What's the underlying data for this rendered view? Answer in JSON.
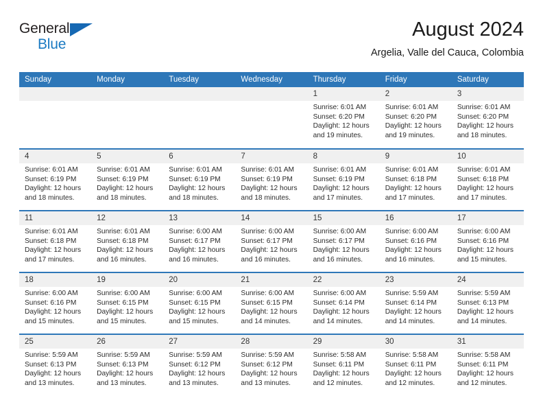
{
  "brand": {
    "name_top": "General",
    "name_bottom": "Blue",
    "flag_icon": "blue-triangle-flag-icon",
    "color_dark": "#231f20",
    "color_blue": "#1b7ac2"
  },
  "header": {
    "title": "August 2024",
    "subtitle": "Argelia, Valle del Cauca, Colombia"
  },
  "theme": {
    "header_blue": "#2e77b8",
    "daynum_gray": "#f0f0f0",
    "text": "#2b2b2b"
  },
  "weekday_headers": [
    "Sunday",
    "Monday",
    "Tuesday",
    "Wednesday",
    "Thursday",
    "Friday",
    "Saturday"
  ],
  "weeks": [
    [
      {
        "day": "",
        "sunrise": "",
        "sunset": "",
        "daylight_line1": "",
        "daylight_line2": ""
      },
      {
        "day": "",
        "sunrise": "",
        "sunset": "",
        "daylight_line1": "",
        "daylight_line2": ""
      },
      {
        "day": "",
        "sunrise": "",
        "sunset": "",
        "daylight_line1": "",
        "daylight_line2": ""
      },
      {
        "day": "",
        "sunrise": "",
        "sunset": "",
        "daylight_line1": "",
        "daylight_line2": ""
      },
      {
        "day": "1",
        "sunrise": "Sunrise: 6:01 AM",
        "sunset": "Sunset: 6:20 PM",
        "daylight_line1": "Daylight: 12 hours",
        "daylight_line2": "and 19 minutes."
      },
      {
        "day": "2",
        "sunrise": "Sunrise: 6:01 AM",
        "sunset": "Sunset: 6:20 PM",
        "daylight_line1": "Daylight: 12 hours",
        "daylight_line2": "and 19 minutes."
      },
      {
        "day": "3",
        "sunrise": "Sunrise: 6:01 AM",
        "sunset": "Sunset: 6:20 PM",
        "daylight_line1": "Daylight: 12 hours",
        "daylight_line2": "and 18 minutes."
      }
    ],
    [
      {
        "day": "4",
        "sunrise": "Sunrise: 6:01 AM",
        "sunset": "Sunset: 6:19 PM",
        "daylight_line1": "Daylight: 12 hours",
        "daylight_line2": "and 18 minutes."
      },
      {
        "day": "5",
        "sunrise": "Sunrise: 6:01 AM",
        "sunset": "Sunset: 6:19 PM",
        "daylight_line1": "Daylight: 12 hours",
        "daylight_line2": "and 18 minutes."
      },
      {
        "day": "6",
        "sunrise": "Sunrise: 6:01 AM",
        "sunset": "Sunset: 6:19 PM",
        "daylight_line1": "Daylight: 12 hours",
        "daylight_line2": "and 18 minutes."
      },
      {
        "day": "7",
        "sunrise": "Sunrise: 6:01 AM",
        "sunset": "Sunset: 6:19 PM",
        "daylight_line1": "Daylight: 12 hours",
        "daylight_line2": "and 18 minutes."
      },
      {
        "day": "8",
        "sunrise": "Sunrise: 6:01 AM",
        "sunset": "Sunset: 6:19 PM",
        "daylight_line1": "Daylight: 12 hours",
        "daylight_line2": "and 17 minutes."
      },
      {
        "day": "9",
        "sunrise": "Sunrise: 6:01 AM",
        "sunset": "Sunset: 6:18 PM",
        "daylight_line1": "Daylight: 12 hours",
        "daylight_line2": "and 17 minutes."
      },
      {
        "day": "10",
        "sunrise": "Sunrise: 6:01 AM",
        "sunset": "Sunset: 6:18 PM",
        "daylight_line1": "Daylight: 12 hours",
        "daylight_line2": "and 17 minutes."
      }
    ],
    [
      {
        "day": "11",
        "sunrise": "Sunrise: 6:01 AM",
        "sunset": "Sunset: 6:18 PM",
        "daylight_line1": "Daylight: 12 hours",
        "daylight_line2": "and 17 minutes."
      },
      {
        "day": "12",
        "sunrise": "Sunrise: 6:01 AM",
        "sunset": "Sunset: 6:18 PM",
        "daylight_line1": "Daylight: 12 hours",
        "daylight_line2": "and 16 minutes."
      },
      {
        "day": "13",
        "sunrise": "Sunrise: 6:00 AM",
        "sunset": "Sunset: 6:17 PM",
        "daylight_line1": "Daylight: 12 hours",
        "daylight_line2": "and 16 minutes."
      },
      {
        "day": "14",
        "sunrise": "Sunrise: 6:00 AM",
        "sunset": "Sunset: 6:17 PM",
        "daylight_line1": "Daylight: 12 hours",
        "daylight_line2": "and 16 minutes."
      },
      {
        "day": "15",
        "sunrise": "Sunrise: 6:00 AM",
        "sunset": "Sunset: 6:17 PM",
        "daylight_line1": "Daylight: 12 hours",
        "daylight_line2": "and 16 minutes."
      },
      {
        "day": "16",
        "sunrise": "Sunrise: 6:00 AM",
        "sunset": "Sunset: 6:16 PM",
        "daylight_line1": "Daylight: 12 hours",
        "daylight_line2": "and 16 minutes."
      },
      {
        "day": "17",
        "sunrise": "Sunrise: 6:00 AM",
        "sunset": "Sunset: 6:16 PM",
        "daylight_line1": "Daylight: 12 hours",
        "daylight_line2": "and 15 minutes."
      }
    ],
    [
      {
        "day": "18",
        "sunrise": "Sunrise: 6:00 AM",
        "sunset": "Sunset: 6:16 PM",
        "daylight_line1": "Daylight: 12 hours",
        "daylight_line2": "and 15 minutes."
      },
      {
        "day": "19",
        "sunrise": "Sunrise: 6:00 AM",
        "sunset": "Sunset: 6:15 PM",
        "daylight_line1": "Daylight: 12 hours",
        "daylight_line2": "and 15 minutes."
      },
      {
        "day": "20",
        "sunrise": "Sunrise: 6:00 AM",
        "sunset": "Sunset: 6:15 PM",
        "daylight_line1": "Daylight: 12 hours",
        "daylight_line2": "and 15 minutes."
      },
      {
        "day": "21",
        "sunrise": "Sunrise: 6:00 AM",
        "sunset": "Sunset: 6:15 PM",
        "daylight_line1": "Daylight: 12 hours",
        "daylight_line2": "and 14 minutes."
      },
      {
        "day": "22",
        "sunrise": "Sunrise: 6:00 AM",
        "sunset": "Sunset: 6:14 PM",
        "daylight_line1": "Daylight: 12 hours",
        "daylight_line2": "and 14 minutes."
      },
      {
        "day": "23",
        "sunrise": "Sunrise: 5:59 AM",
        "sunset": "Sunset: 6:14 PM",
        "daylight_line1": "Daylight: 12 hours",
        "daylight_line2": "and 14 minutes."
      },
      {
        "day": "24",
        "sunrise": "Sunrise: 5:59 AM",
        "sunset": "Sunset: 6:13 PM",
        "daylight_line1": "Daylight: 12 hours",
        "daylight_line2": "and 14 minutes."
      }
    ],
    [
      {
        "day": "25",
        "sunrise": "Sunrise: 5:59 AM",
        "sunset": "Sunset: 6:13 PM",
        "daylight_line1": "Daylight: 12 hours",
        "daylight_line2": "and 13 minutes."
      },
      {
        "day": "26",
        "sunrise": "Sunrise: 5:59 AM",
        "sunset": "Sunset: 6:13 PM",
        "daylight_line1": "Daylight: 12 hours",
        "daylight_line2": "and 13 minutes."
      },
      {
        "day": "27",
        "sunrise": "Sunrise: 5:59 AM",
        "sunset": "Sunset: 6:12 PM",
        "daylight_line1": "Daylight: 12 hours",
        "daylight_line2": "and 13 minutes."
      },
      {
        "day": "28",
        "sunrise": "Sunrise: 5:59 AM",
        "sunset": "Sunset: 6:12 PM",
        "daylight_line1": "Daylight: 12 hours",
        "daylight_line2": "and 13 minutes."
      },
      {
        "day": "29",
        "sunrise": "Sunrise: 5:58 AM",
        "sunset": "Sunset: 6:11 PM",
        "daylight_line1": "Daylight: 12 hours",
        "daylight_line2": "and 12 minutes."
      },
      {
        "day": "30",
        "sunrise": "Sunrise: 5:58 AM",
        "sunset": "Sunset: 6:11 PM",
        "daylight_line1": "Daylight: 12 hours",
        "daylight_line2": "and 12 minutes."
      },
      {
        "day": "31",
        "sunrise": "Sunrise: 5:58 AM",
        "sunset": "Sunset: 6:11 PM",
        "daylight_line1": "Daylight: 12 hours",
        "daylight_line2": "and 12 minutes."
      }
    ]
  ]
}
